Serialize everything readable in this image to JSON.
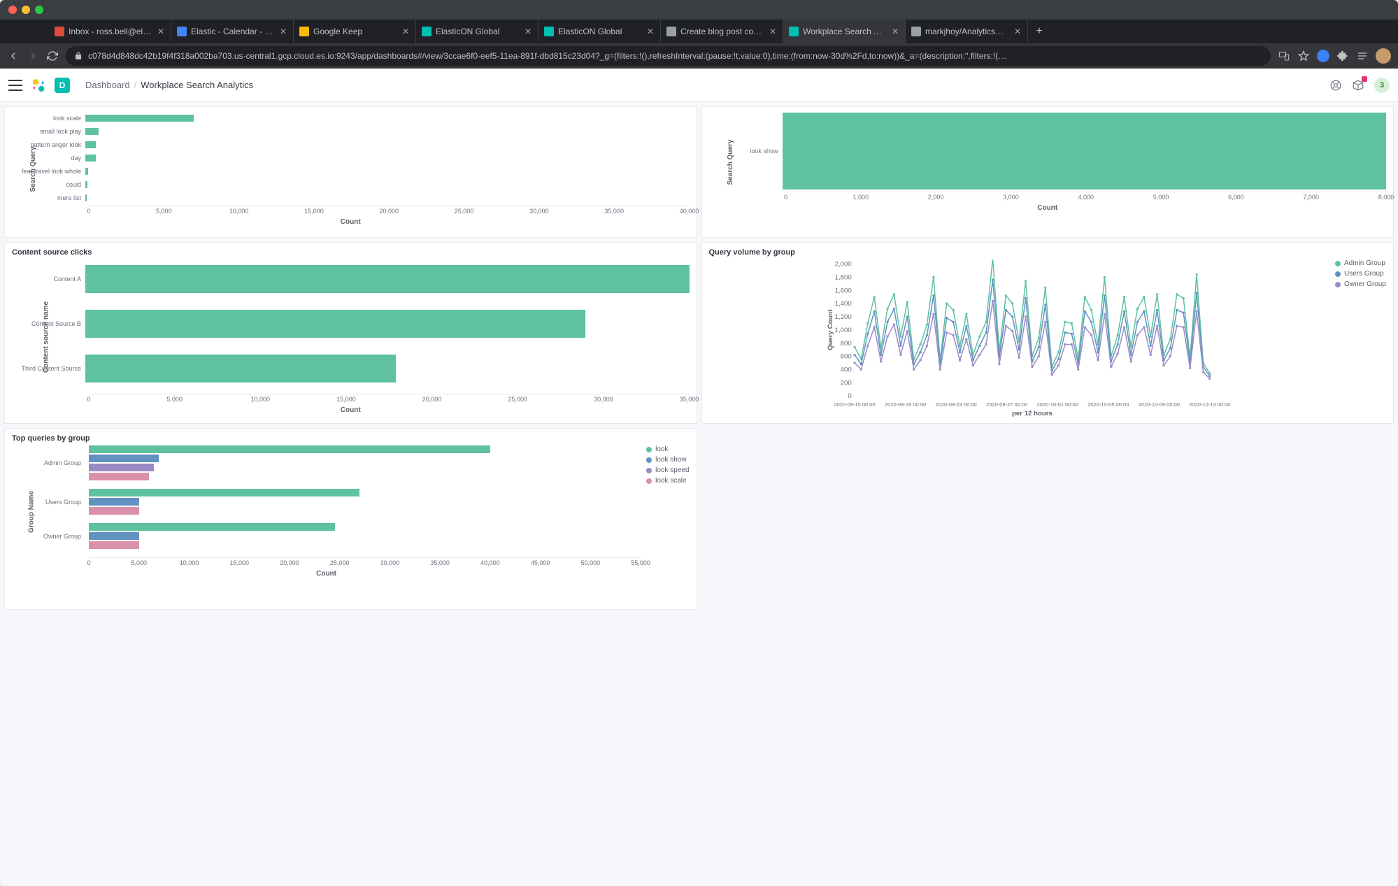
{
  "browser": {
    "tabs": [
      {
        "icon": "#dd4b39",
        "label": "Inbox - ross.bell@elastic.co -"
      },
      {
        "icon": "#4285f4",
        "label": "Elastic - Calendar - Week of D"
      },
      {
        "icon": "#fbbc05",
        "label": "Google Keep"
      },
      {
        "icon": "#00bfb3",
        "label": "ElasticON Global"
      },
      {
        "icon": "#00bfb3",
        "label": "ElasticON Global"
      },
      {
        "icon": "#9aa0a6",
        "label": "Create blog post content to ill"
      },
      {
        "icon": "#00bfb3",
        "label": "Workplace Search Analytics -",
        "active": true
      },
      {
        "icon": "#9aa0a6",
        "label": "markjhoy/AnalyticsGenerator"
      }
    ],
    "url": "c078d4d848dc42b19f4f318a002ba703.us-central1.gcp.cloud.es.io:9243/app/dashboards#/view/3ccae6f0-eef5-11ea-891f-dbd815c23d04?_g=(filters:!(),refreshInterval:(pause:!t,value:0),time:(from:now-30d%2Fd,to:now))&_a=(description:'',filters:!(…"
  },
  "header": {
    "space": "D",
    "breadcrumb_root": "Dashboard",
    "breadcrumb_current": "Workplace Search Analytics",
    "notification_count": "3"
  },
  "colors": {
    "teal": "#5ec2a1",
    "blue": "#6192c0",
    "purple": "#9b8bc5",
    "pink": "#d991ab"
  },
  "chart_data": [
    {
      "id": "top_left",
      "type": "bar",
      "orientation": "h",
      "title": "",
      "xlabel": "Count",
      "ylabel": "Search Query",
      "xlim": [
        0,
        40000
      ],
      "xticks": [
        0,
        5000,
        10000,
        15000,
        20000,
        25000,
        30000,
        35000,
        40000
      ],
      "categories": [
        "look scale",
        "small look play",
        "pattern anger look",
        "day",
        "fear travel look whole",
        "could",
        "mere list"
      ],
      "values": [
        7200,
        900,
        700,
        700,
        200,
        150,
        100
      ]
    },
    {
      "id": "top_right",
      "type": "bar",
      "orientation": "h",
      "title": "",
      "xlabel": "Count",
      "ylabel": "Search Query",
      "xlim": [
        0,
        8000
      ],
      "xticks": [
        0,
        1000,
        2000,
        3000,
        4000,
        5000,
        6000,
        7000,
        8000
      ],
      "categories": [
        "look show"
      ],
      "values": [
        8000
      ]
    },
    {
      "id": "content_source_clicks",
      "type": "bar",
      "orientation": "h",
      "title": "Content source clicks",
      "xlabel": "Count",
      "ylabel": "Content source name",
      "xlim": [
        0,
        35000
      ],
      "xticks": [
        0,
        5000,
        10000,
        15000,
        20000,
        25000,
        30000,
        35000
      ],
      "categories": [
        "Content A",
        "Content Source B",
        "Third Content Source"
      ],
      "values": [
        35000,
        29000,
        18000
      ]
    },
    {
      "id": "query_volume_by_group",
      "type": "line",
      "title": "Query volume by group",
      "xlabel": "per 12 hours",
      "ylabel": "Query Count",
      "ylim": [
        0,
        2000
      ],
      "yticks": [
        0,
        200,
        400,
        600,
        800,
        1000,
        1200,
        1400,
        1600,
        1800,
        2000
      ],
      "xticks": [
        "2020-09-15 00:00",
        "2020-09-19 00:00",
        "2020-09-23 00:00",
        "2020-09-27 00:00",
        "2020-10-01 00:00",
        "2020-10-05 00:00",
        "2020-10-09 00:00",
        "2020-10-13 00:00"
      ],
      "series": [
        {
          "name": "Admin Group",
          "color": "#5ec2a1",
          "values": [
            740,
            560,
            1100,
            1500,
            720,
            1320,
            1540,
            900,
            1420,
            550,
            780,
            1080,
            1800,
            540,
            1400,
            1300,
            760,
            1240,
            620,
            900,
            1120,
            2080,
            680,
            1520,
            1400,
            820,
            1740,
            600,
            880,
            1640,
            440,
            660,
            1120,
            1100,
            560,
            1500,
            1300,
            780,
            1800,
            600,
            920,
            1500,
            740,
            1320,
            1500,
            900,
            1540,
            620,
            860,
            1540,
            1480,
            580,
            1840,
            500,
            340
          ]
        },
        {
          "name": "Users Group",
          "color": "#6192c0",
          "values": [
            620,
            480,
            940,
            1280,
            620,
            1120,
            1320,
            760,
            1200,
            480,
            660,
            920,
            1520,
            480,
            1180,
            1120,
            660,
            1060,
            540,
            760,
            960,
            1760,
            580,
            1300,
            1200,
            700,
            1480,
            520,
            740,
            1380,
            380,
            560,
            960,
            940,
            480,
            1280,
            1120,
            660,
            1520,
            520,
            780,
            1280,
            620,
            1120,
            1280,
            760,
            1300,
            540,
            720,
            1300,
            1260,
            500,
            1560,
            440,
            300
          ]
        },
        {
          "name": "Owner Group",
          "color": "#9b8bc5",
          "values": [
            500,
            400,
            760,
            1040,
            520,
            900,
            1080,
            620,
            980,
            400,
            540,
            760,
            1240,
            400,
            960,
            920,
            540,
            860,
            460,
            620,
            780,
            1440,
            480,
            1060,
            980,
            580,
            1200,
            440,
            600,
            1120,
            320,
            460,
            780,
            780,
            400,
            1040,
            920,
            540,
            1240,
            440,
            640,
            1040,
            520,
            920,
            1040,
            620,
            1060,
            460,
            600,
            1060,
            1040,
            420,
            1280,
            360,
            260
          ]
        }
      ]
    },
    {
      "id": "top_queries_by_group",
      "type": "bar",
      "orientation": "h",
      "title": "Top queries by group",
      "xlabel": "Count",
      "ylabel": "Group Name",
      "xlim": [
        0,
        55000
      ],
      "xticks": [
        0,
        5000,
        10000,
        15000,
        20000,
        25000,
        30000,
        35000,
        40000,
        45000,
        50000,
        55000
      ],
      "groups": [
        "Admin Group",
        "Users Group",
        "Owner Group"
      ],
      "series": [
        {
          "name": "look",
          "color": "#5ec2a1",
          "values": [
            40000,
            27000,
            24500
          ]
        },
        {
          "name": "look show",
          "color": "#6192c0",
          "values": [
            7000,
            5000,
            5000
          ]
        },
        {
          "name": "look speed",
          "color": "#9b8bc5",
          "values": [
            6500,
            0,
            0
          ]
        },
        {
          "name": "look scale",
          "color": "#d991ab",
          "values": [
            6000,
            5000,
            5000
          ]
        }
      ]
    }
  ]
}
